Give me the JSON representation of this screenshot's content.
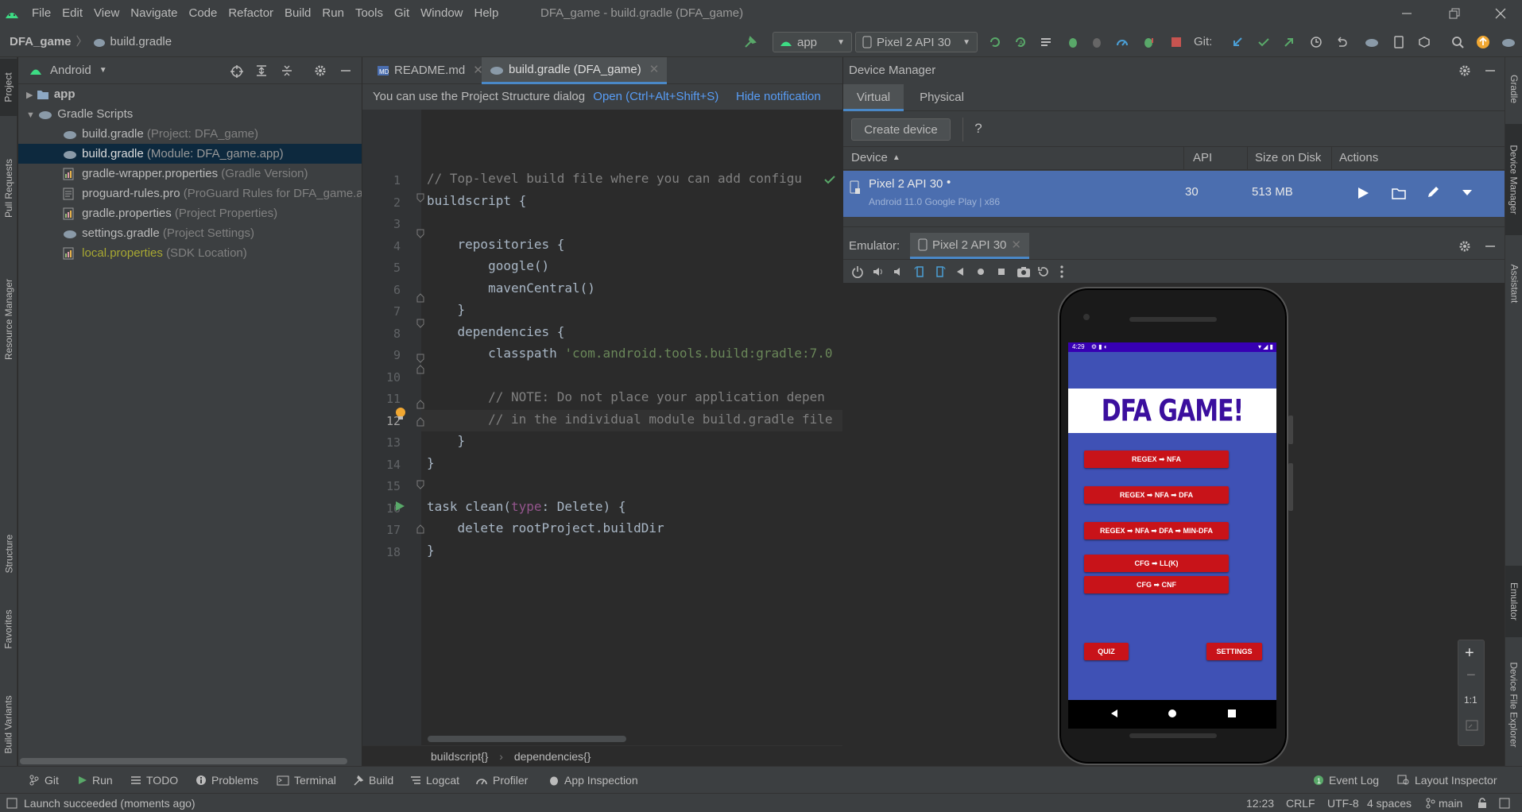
{
  "window": {
    "title": "DFA_game - build.gradle (DFA_game)",
    "menu": [
      "File",
      "Edit",
      "View",
      "Navigate",
      "Code",
      "Refactor",
      "Build",
      "Run",
      "Tools",
      "Git",
      "Window",
      "Help"
    ]
  },
  "breadcrumb": {
    "project": "DFA_game",
    "file": "build.gradle"
  },
  "toolbar": {
    "run_config": "app",
    "device": "Pixel 2 API 30",
    "git_label": "Git:"
  },
  "project_panel": {
    "view": "Android",
    "items": [
      {
        "label": "app",
        "hint": ""
      },
      {
        "label": "Gradle Scripts",
        "hint": ""
      },
      {
        "label": "build.gradle",
        "hint": "(Project: DFA_game)"
      },
      {
        "label": "build.gradle",
        "hint": "(Module: DFA_game.app)"
      },
      {
        "label": "gradle-wrapper.properties",
        "hint": "(Gradle Version)"
      },
      {
        "label": "proguard-rules.pro",
        "hint": "(ProGuard Rules for DFA_game.ap"
      },
      {
        "label": "gradle.properties",
        "hint": "(Project Properties)"
      },
      {
        "label": "settings.gradle",
        "hint": "(Project Settings)"
      },
      {
        "label": "local.properties",
        "hint": "(SDK Location)"
      }
    ]
  },
  "left_tabs": {
    "project": "Project",
    "pull_requests": "Pull Requests",
    "resource_manager": "Resource Manager",
    "structure": "Structure",
    "favorites": "Favorites",
    "build_variants": "Build Variants"
  },
  "right_tabs": {
    "gradle": "Gradle",
    "device_manager": "Device Manager",
    "assistant": "Assistant",
    "emulator": "Emulator",
    "device_file_explorer": "Device File Explorer"
  },
  "editor": {
    "tabs": [
      "README.md",
      "build.gradle (DFA_game)"
    ],
    "notification": {
      "text": "You can use the Project Structure dialog",
      "action": "Open (Ctrl+Alt+Shift+S)",
      "hide": "Hide notification"
    },
    "line_numbers": [
      "1",
      "2",
      "3",
      "4",
      "5",
      "6",
      "7",
      "8",
      "9",
      "10",
      "11",
      "12",
      "13",
      "14",
      "15",
      "16",
      "17",
      "18"
    ],
    "code": {
      "l1": "// Top-level build file where you can add configu",
      "l2": "buildscript {",
      "l4": "    repositories {",
      "l5": "        google()",
      "l6": "        mavenCentral()",
      "l7": "    }",
      "l8": "    dependencies {",
      "l9a": "        classpath ",
      "l9b": "'com.android.tools.build:gradle:7.0",
      "l11": "        // NOTE: Do not place your application depen",
      "l12": "        // in the individual module build.gradle file",
      "l13": "    }",
      "l14": "}",
      "l16a": "task clean(",
      "l16b": "type",
      "l16c": ": Delete) {",
      "l17": "    delete rootProject.buildDir",
      "l18": "}"
    },
    "crumbs": [
      "buildscript{}",
      "dependencies{}"
    ]
  },
  "device_manager": {
    "title": "Device Manager",
    "tabs": [
      "Virtual",
      "Physical"
    ],
    "create": "Create device",
    "help": "?",
    "columns": [
      "Device",
      "API",
      "Size on Disk",
      "Actions"
    ],
    "row": {
      "name": "Pixel 2 API 30",
      "sub": "Android 11.0 Google Play | x86",
      "api": "30",
      "size": "513 MB"
    }
  },
  "emulator": {
    "label": "Emulator:",
    "tab": "Pixel 2 API 30",
    "zoom": "1:1"
  },
  "phone": {
    "time": "4:29",
    "app_title": "DFA GAME!",
    "buttons": [
      "REGEX ➡ NFA",
      "REGEX ➡ NFA ➡ DFA",
      "REGEX ➡ NFA ➡ DFA ➡ MIN-DFA",
      "CFG ➡ LL(K)",
      "CFG ➡ CNF"
    ],
    "quiz": "QUIZ",
    "settings": "SETTINGS"
  },
  "bottom_tools": [
    "Git",
    "Run",
    "TODO",
    "Problems",
    "Terminal",
    "Build",
    "Logcat",
    "Profiler",
    "App Inspection"
  ],
  "bottom_right": [
    "Event Log",
    "Layout Inspector"
  ],
  "status": {
    "message": "Launch succeeded (moments ago)",
    "position": "12:23",
    "line_sep": "CRLF",
    "encoding": "UTF-8",
    "indent": "4 spaces",
    "branch": "main"
  },
  "colors": {
    "accent": "#4b6eaf",
    "selection": "#0d293e",
    "app_bg": "#3f51b5",
    "app_button": "#c81319",
    "title_purple": "#3b0f9e"
  }
}
